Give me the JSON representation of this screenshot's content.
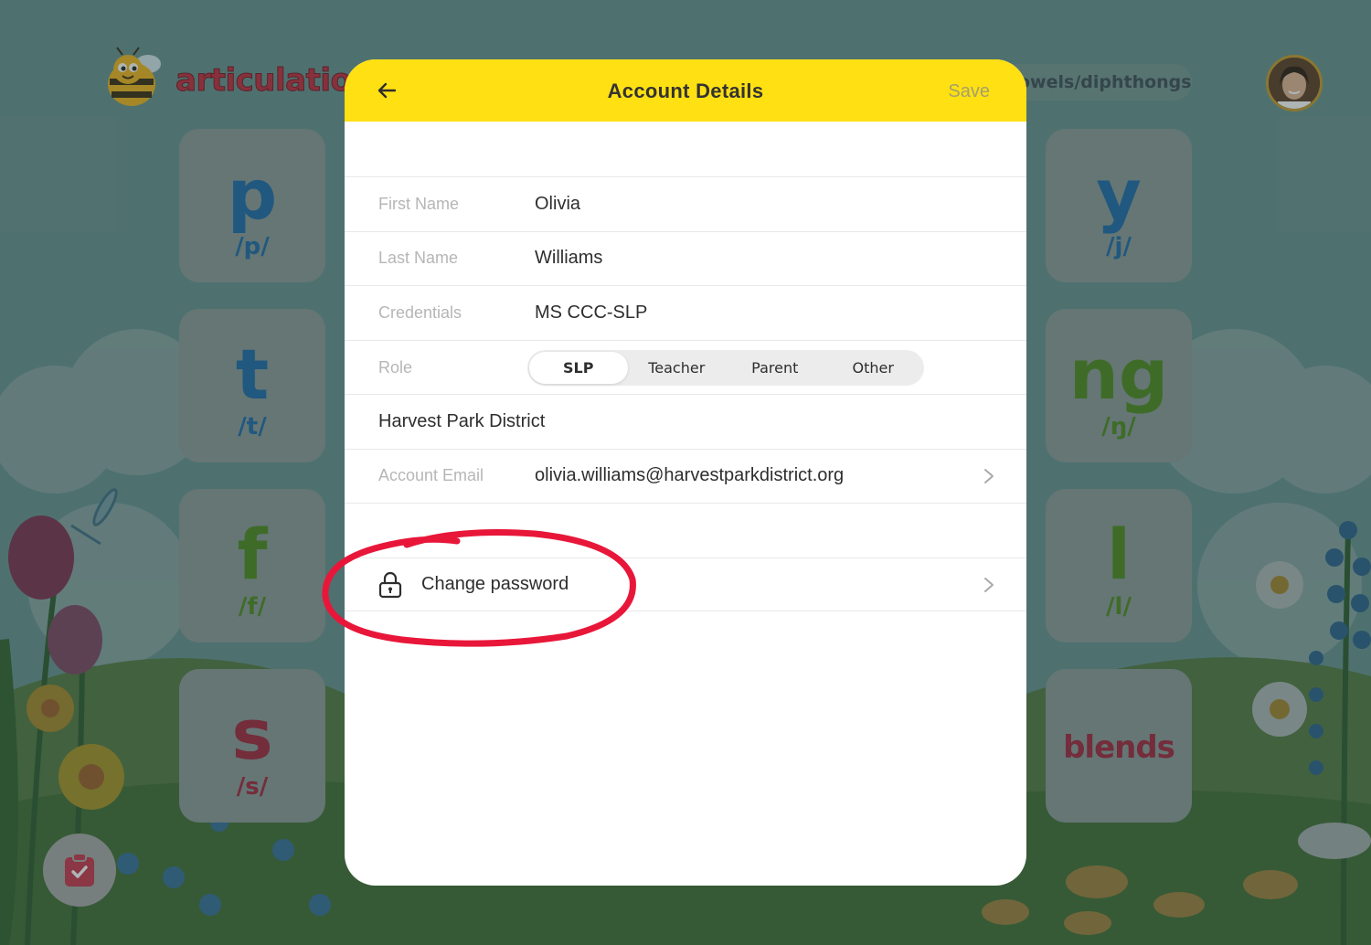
{
  "app": {
    "logo_text": "articulatio",
    "category_pill": "owels/diphthongs"
  },
  "cards": [
    {
      "letter": "p",
      "ipa": "/p/",
      "color": "#1c6aa8"
    },
    {
      "letter": "t",
      "ipa": "/t/",
      "color": "#1c6aa8"
    },
    {
      "letter": "f",
      "ipa": "/f/",
      "color": "#4c8a1c"
    },
    {
      "letter": "s",
      "ipa": "/s/",
      "color": "#a3243a"
    },
    {
      "letter": "y",
      "ipa": "/j/",
      "color": "#1c6aa8"
    },
    {
      "letter": "ng",
      "ipa": "/ŋ/",
      "color": "#4c8a1c"
    },
    {
      "letter": "l",
      "ipa": "/l/",
      "color": "#4c8a1c"
    },
    {
      "letter": "blends",
      "ipa": "",
      "color": "#a3243a"
    }
  ],
  "modal": {
    "title": "Account Details",
    "back_icon": "arrow-left-icon",
    "save_label": "Save",
    "header_color": "#ffe012",
    "fields": {
      "first_name": {
        "label": "First Name",
        "value": "Olivia"
      },
      "last_name": {
        "label": "Last Name",
        "value": "Williams"
      },
      "credentials": {
        "label": "Credentials",
        "value": "MS CCC-SLP"
      },
      "role": {
        "label": "Role",
        "options": [
          "SLP",
          "Teacher",
          "Parent",
          "Other"
        ],
        "selected": "SLP"
      },
      "district": {
        "value": "Harvest Park District"
      },
      "email": {
        "label": "Account Email",
        "value": "olivia.williams@harvestparkdistrict.org"
      }
    },
    "change_password": {
      "label": "Change password",
      "icon": "lock-icon"
    }
  },
  "annotation": {
    "color": "#e8173a",
    "shape": "circle around change-password row"
  }
}
